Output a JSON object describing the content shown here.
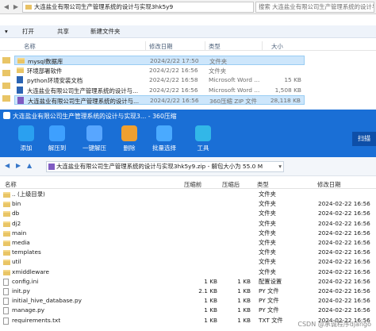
{
  "explorer": {
    "address": "大连盐业有限公司生产管理系统的设计与实现3hk5y9",
    "search_placeholder": "搜索 大连盐业有限公司生产管理系统的设计与实现3hk5y9",
    "toolbar": {
      "open": "打开",
      "share": "共享",
      "new_folder": "新建文件夹"
    },
    "columns": {
      "name": "名称",
      "modified": "修改日期",
      "type": "类型",
      "size": "大小"
    },
    "files": [
      {
        "name": "mysql数据库",
        "modified": "2024/2/22 17:50",
        "type": "文件夹",
        "size": "",
        "icon": "folder"
      },
      {
        "name": "环境部署软件",
        "modified": "2024/2/22 16:56",
        "type": "文件夹",
        "size": "",
        "icon": "folder"
      },
      {
        "name": "python环境安装文档",
        "modified": "2024/2/22 16:58",
        "type": "Microsoft Word ...",
        "size": "15 KB",
        "icon": "doc"
      },
      {
        "name": "大连盐业有限公司生产管理系统的设计与...",
        "modified": "2024/2/22 16:56",
        "type": "Microsoft Word ...",
        "size": "1,508 KB",
        "icon": "doc"
      },
      {
        "name": "大连盐业有限公司生产管理系统的设计与...",
        "modified": "2024/2/22 16:56",
        "type": "360压缩 ZIP 文件",
        "size": "28,118 KB",
        "icon": "zip"
      }
    ]
  },
  "zip": {
    "title": "大连盐业有限公司生产管理系统的设计与实现3... - 360压缩",
    "toolbar": [
      {
        "label": "添加",
        "icon": "add-icon",
        "color": "#2aa0f0"
      },
      {
        "label": "解压到",
        "icon": "extract-to-icon",
        "color": "#3ea0ff"
      },
      {
        "label": "一键解压",
        "icon": "one-click-extract-icon",
        "color": "#58a6ff"
      },
      {
        "label": "删除",
        "icon": "delete-icon",
        "color": "#f0a030"
      },
      {
        "label": "批量选择",
        "icon": "batch-select-icon",
        "color": "#4aaaff"
      },
      {
        "label": "工具",
        "icon": "tools-icon",
        "color": "#32b7e8"
      }
    ],
    "scan": "扫描",
    "path": "大连盐业有限公司生产管理系统的设计与实现3hk5y9.zip - 解包大小为 55.0 M",
    "columns": {
      "name": "名称",
      "compressed": "压缩前",
      "original": "压缩后",
      "type": "类型",
      "modified": "修改日期"
    },
    "rows": [
      {
        "name": ".. (上级目录)",
        "compressed": "",
        "original": "",
        "type": "文件夹",
        "modified": "",
        "icon": "folder"
      },
      {
        "name": "bin",
        "compressed": "",
        "original": "",
        "type": "文件夹",
        "modified": "2024-02-22 16:56",
        "icon": "folder"
      },
      {
        "name": "db",
        "compressed": "",
        "original": "",
        "type": "文件夹",
        "modified": "2024-02-22 16:56",
        "icon": "folder"
      },
      {
        "name": "dj2",
        "compressed": "",
        "original": "",
        "type": "文件夹",
        "modified": "2024-02-22 16:56",
        "icon": "folder"
      },
      {
        "name": "main",
        "compressed": "",
        "original": "",
        "type": "文件夹",
        "modified": "2024-02-22 16:56",
        "icon": "folder"
      },
      {
        "name": "media",
        "compressed": "",
        "original": "",
        "type": "文件夹",
        "modified": "2024-02-22 16:56",
        "icon": "folder"
      },
      {
        "name": "templates",
        "compressed": "",
        "original": "",
        "type": "文件夹",
        "modified": "2024-02-22 16:56",
        "icon": "folder"
      },
      {
        "name": "util",
        "compressed": "",
        "original": "",
        "type": "文件夹",
        "modified": "2024-02-22 16:56",
        "icon": "folder"
      },
      {
        "name": "xmiddleware",
        "compressed": "",
        "original": "",
        "type": "文件夹",
        "modified": "2024-02-22 16:56",
        "icon": "folder"
      },
      {
        "name": "config.ini",
        "compressed": "1 KB",
        "original": "1 KB",
        "type": "配置设置",
        "modified": "2024-02-22 16:56",
        "icon": "file"
      },
      {
        "name": "init.py",
        "compressed": "2.1 KB",
        "original": "1 KB",
        "type": "PY 文件",
        "modified": "2024-02-22 16:56",
        "icon": "file"
      },
      {
        "name": "initial_hive_database.py",
        "compressed": "1 KB",
        "original": "1 KB",
        "type": "PY 文件",
        "modified": "2024-02-22 16:56",
        "icon": "file"
      },
      {
        "name": "manage.py",
        "compressed": "1 KB",
        "original": "1 KB",
        "type": "PY 文件",
        "modified": "2024-02-22 16:56",
        "icon": "file"
      },
      {
        "name": "requirements.txt",
        "compressed": "1 KB",
        "original": "1 KB",
        "type": "TXT 文件",
        "modified": "2024-02-22 16:56",
        "icon": "file"
      }
    ]
  },
  "watermark": "CSDN @承诚程序django"
}
